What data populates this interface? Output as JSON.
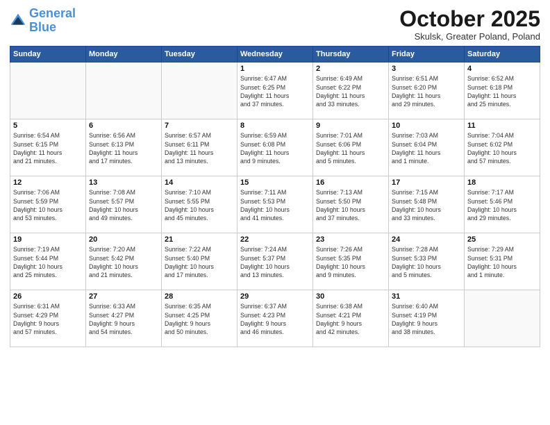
{
  "logo": {
    "line1": "General",
    "line2": "Blue"
  },
  "title": "October 2025",
  "subtitle": "Skulsk, Greater Poland, Poland",
  "days_header": [
    "Sunday",
    "Monday",
    "Tuesday",
    "Wednesday",
    "Thursday",
    "Friday",
    "Saturday"
  ],
  "weeks": [
    [
      {
        "num": "",
        "info": ""
      },
      {
        "num": "",
        "info": ""
      },
      {
        "num": "",
        "info": ""
      },
      {
        "num": "1",
        "info": "Sunrise: 6:47 AM\nSunset: 6:25 PM\nDaylight: 11 hours\nand 37 minutes."
      },
      {
        "num": "2",
        "info": "Sunrise: 6:49 AM\nSunset: 6:22 PM\nDaylight: 11 hours\nand 33 minutes."
      },
      {
        "num": "3",
        "info": "Sunrise: 6:51 AM\nSunset: 6:20 PM\nDaylight: 11 hours\nand 29 minutes."
      },
      {
        "num": "4",
        "info": "Sunrise: 6:52 AM\nSunset: 6:18 PM\nDaylight: 11 hours\nand 25 minutes."
      }
    ],
    [
      {
        "num": "5",
        "info": "Sunrise: 6:54 AM\nSunset: 6:15 PM\nDaylight: 11 hours\nand 21 minutes."
      },
      {
        "num": "6",
        "info": "Sunrise: 6:56 AM\nSunset: 6:13 PM\nDaylight: 11 hours\nand 17 minutes."
      },
      {
        "num": "7",
        "info": "Sunrise: 6:57 AM\nSunset: 6:11 PM\nDaylight: 11 hours\nand 13 minutes."
      },
      {
        "num": "8",
        "info": "Sunrise: 6:59 AM\nSunset: 6:08 PM\nDaylight: 11 hours\nand 9 minutes."
      },
      {
        "num": "9",
        "info": "Sunrise: 7:01 AM\nSunset: 6:06 PM\nDaylight: 11 hours\nand 5 minutes."
      },
      {
        "num": "10",
        "info": "Sunrise: 7:03 AM\nSunset: 6:04 PM\nDaylight: 11 hours\nand 1 minute."
      },
      {
        "num": "11",
        "info": "Sunrise: 7:04 AM\nSunset: 6:02 PM\nDaylight: 10 hours\nand 57 minutes."
      }
    ],
    [
      {
        "num": "12",
        "info": "Sunrise: 7:06 AM\nSunset: 5:59 PM\nDaylight: 10 hours\nand 53 minutes."
      },
      {
        "num": "13",
        "info": "Sunrise: 7:08 AM\nSunset: 5:57 PM\nDaylight: 10 hours\nand 49 minutes."
      },
      {
        "num": "14",
        "info": "Sunrise: 7:10 AM\nSunset: 5:55 PM\nDaylight: 10 hours\nand 45 minutes."
      },
      {
        "num": "15",
        "info": "Sunrise: 7:11 AM\nSunset: 5:53 PM\nDaylight: 10 hours\nand 41 minutes."
      },
      {
        "num": "16",
        "info": "Sunrise: 7:13 AM\nSunset: 5:50 PM\nDaylight: 10 hours\nand 37 minutes."
      },
      {
        "num": "17",
        "info": "Sunrise: 7:15 AM\nSunset: 5:48 PM\nDaylight: 10 hours\nand 33 minutes."
      },
      {
        "num": "18",
        "info": "Sunrise: 7:17 AM\nSunset: 5:46 PM\nDaylight: 10 hours\nand 29 minutes."
      }
    ],
    [
      {
        "num": "19",
        "info": "Sunrise: 7:19 AM\nSunset: 5:44 PM\nDaylight: 10 hours\nand 25 minutes."
      },
      {
        "num": "20",
        "info": "Sunrise: 7:20 AM\nSunset: 5:42 PM\nDaylight: 10 hours\nand 21 minutes."
      },
      {
        "num": "21",
        "info": "Sunrise: 7:22 AM\nSunset: 5:40 PM\nDaylight: 10 hours\nand 17 minutes."
      },
      {
        "num": "22",
        "info": "Sunrise: 7:24 AM\nSunset: 5:37 PM\nDaylight: 10 hours\nand 13 minutes."
      },
      {
        "num": "23",
        "info": "Sunrise: 7:26 AM\nSunset: 5:35 PM\nDaylight: 10 hours\nand 9 minutes."
      },
      {
        "num": "24",
        "info": "Sunrise: 7:28 AM\nSunset: 5:33 PM\nDaylight: 10 hours\nand 5 minutes."
      },
      {
        "num": "25",
        "info": "Sunrise: 7:29 AM\nSunset: 5:31 PM\nDaylight: 10 hours\nand 1 minute."
      }
    ],
    [
      {
        "num": "26",
        "info": "Sunrise: 6:31 AM\nSunset: 4:29 PM\nDaylight: 9 hours\nand 57 minutes."
      },
      {
        "num": "27",
        "info": "Sunrise: 6:33 AM\nSunset: 4:27 PM\nDaylight: 9 hours\nand 54 minutes."
      },
      {
        "num": "28",
        "info": "Sunrise: 6:35 AM\nSunset: 4:25 PM\nDaylight: 9 hours\nand 50 minutes."
      },
      {
        "num": "29",
        "info": "Sunrise: 6:37 AM\nSunset: 4:23 PM\nDaylight: 9 hours\nand 46 minutes."
      },
      {
        "num": "30",
        "info": "Sunrise: 6:38 AM\nSunset: 4:21 PM\nDaylight: 9 hours\nand 42 minutes."
      },
      {
        "num": "31",
        "info": "Sunrise: 6:40 AM\nSunset: 4:19 PM\nDaylight: 9 hours\nand 38 minutes."
      },
      {
        "num": "",
        "info": ""
      }
    ]
  ]
}
